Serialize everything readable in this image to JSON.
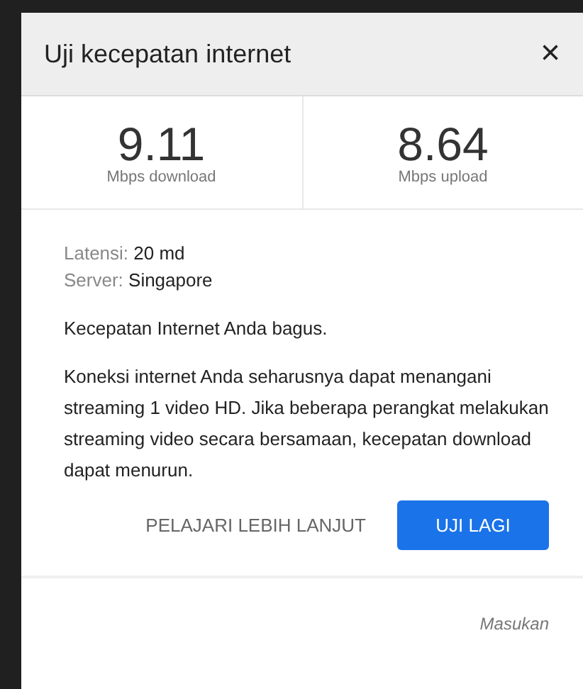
{
  "dialog": {
    "title": "Uji kecepatan internet",
    "close": "×"
  },
  "results": [
    {
      "value": "9.11",
      "unit": "Mbps download"
    },
    {
      "value": "8.64",
      "unit": "Mbps upload"
    }
  ],
  "details": [
    {
      "label": "Latensi:",
      "value": "20 md"
    },
    {
      "label": "Server:",
      "value": "Singapore"
    }
  ],
  "summary": "Kecepatan Internet Anda bagus.",
  "description": "Koneksi internet Anda seharusnya dapat menangani streaming 1 video HD. Jika beberapa perangkat melakukan streaming video secara bersamaan, kecepatan download dapat menurun.",
  "actions": {
    "learn_more": "PELAJARI LEBIH LANJUT",
    "retest": "UJI LAGI"
  },
  "feedback": "Masukan"
}
